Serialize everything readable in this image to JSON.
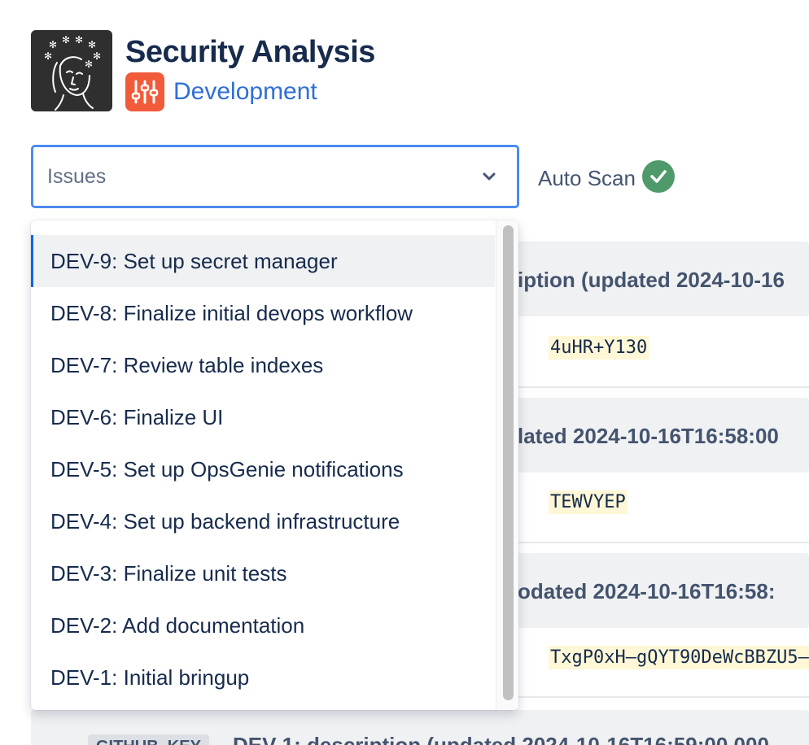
{
  "header": {
    "app_title": "Security Analysis",
    "project_name": "Development"
  },
  "issue_select": {
    "value": "Issues"
  },
  "auto_scan": {
    "label": "Auto Scan",
    "status": "enabled"
  },
  "dropdown": {
    "selected_index": 0,
    "options": [
      "DEV-9: Set up secret manager",
      "DEV-8: Finalize initial devops workflow",
      "DEV-7: Review table indexes",
      "DEV-6: Finalize UI",
      "DEV-5: Set up OpsGenie notifications",
      "DEV-4: Set up backend infrastructure",
      "DEV-3: Finalize unit tests",
      "DEV-2: Add documentation",
      "DEV-1: Initial bringup"
    ]
  },
  "findings": [
    {
      "heading": "iption (updated 2024-10-16",
      "secret": "4uHR+Y130"
    },
    {
      "heading": "lated 2024-10-16T16:58:00",
      "secret": "TEWVYEP"
    },
    {
      "heading": "odated 2024-10-16T16:58:",
      "secret": "TxgP0xH—gQYT90DeWcBBZU5—"
    }
  ],
  "last_finding": {
    "tag": "GITHUB_KEY",
    "heading": "DEV-1: description (updated 2024-10-16T16:59:00.000"
  },
  "colors": {
    "accent": "#0c66e4",
    "focus_border": "#4c8bf0",
    "project_icon": "#f15b3a",
    "success": "#4e9a6a",
    "secret_highlight": "#fff7d6"
  }
}
